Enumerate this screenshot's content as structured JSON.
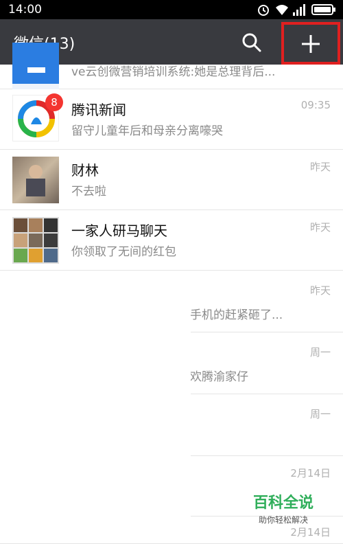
{
  "status_bar": {
    "time": "14:00",
    "icons": [
      "alarm-icon",
      "wifi-icon",
      "signal-icon",
      "battery-icon"
    ]
  },
  "app_bar": {
    "title": "微信(13)",
    "search_icon": "search-icon",
    "add_icon": "plus-icon"
  },
  "chats": [
    {
      "name": "",
      "message": "ve云创微营销培训系统:她是总理背后...",
      "time": ""
    },
    {
      "name": "腾讯新闻",
      "message": "留守儿童年后和母亲分离嚎哭",
      "time": "09:35",
      "badge": "8"
    },
    {
      "name": "财林",
      "message": "不去啦",
      "time": "昨天"
    },
    {
      "name": "一家人研马聊天",
      "message": "你领取了无间的红包",
      "time": "昨天"
    },
    {
      "name": "",
      "message": "手机的赶紧砸了...",
      "time": "昨天"
    },
    {
      "name": "",
      "message": "欢腾渝家仔",
      "time": "周一"
    },
    {
      "name": "",
      "message": "",
      "time": "周一"
    },
    {
      "name": "",
      "message": "",
      "time": "2月14日"
    },
    {
      "name": "",
      "message": "",
      "time": "2月14日"
    }
  ],
  "watermark": {
    "main": "百科全说",
    "sub": "助你轻松解决"
  }
}
